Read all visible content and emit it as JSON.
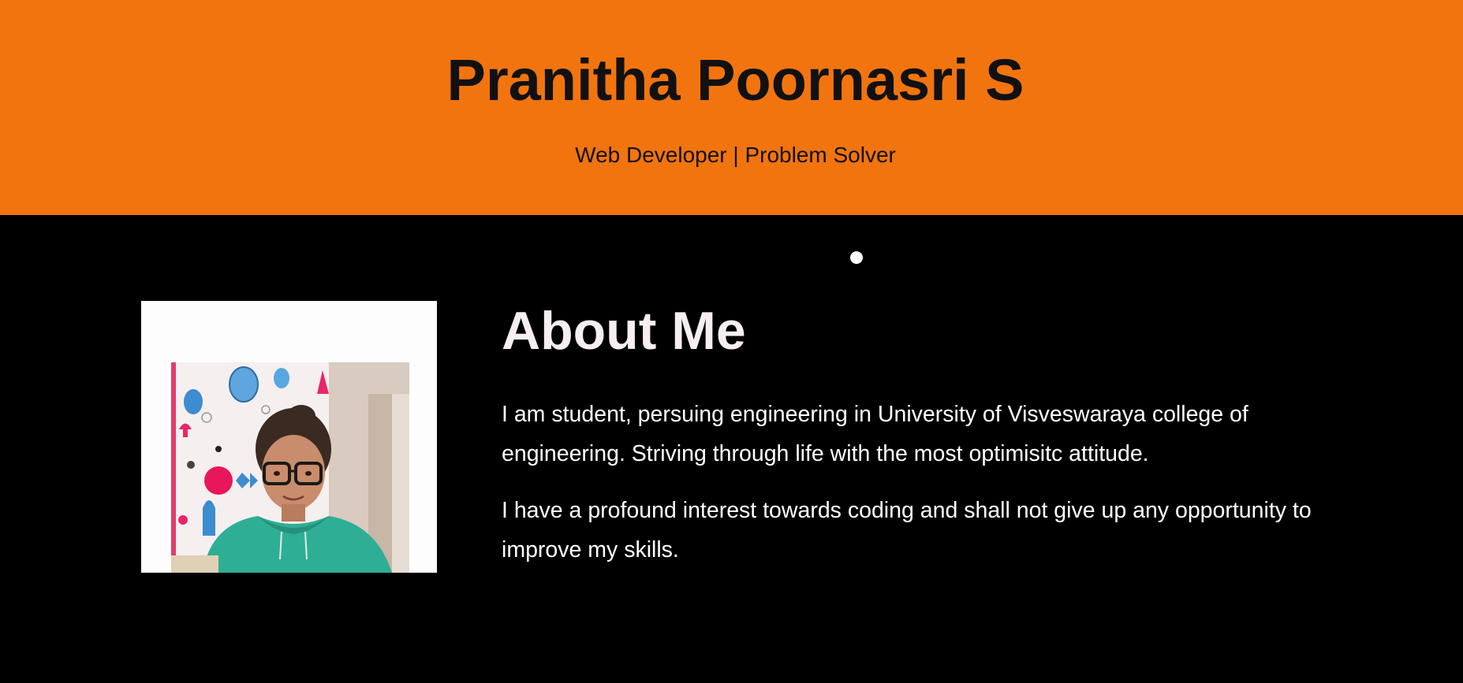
{
  "header": {
    "name": "Pranitha Poornasri S",
    "tagline": "Web Developer | Problem Solver"
  },
  "about": {
    "title": "About Me",
    "paragraphs": [
      "I am student, persuing engineering in University of Visveswaraya college of engineering. Striving through life with the most optimisitc attitude.",
      "I have a profound interest towards coding and shall not give up any opportunity to improve my skills."
    ]
  },
  "colors": {
    "header_bg": "#f2740f",
    "page_bg": "#000000",
    "title_text": "#111111",
    "body_text": "#ffffff"
  }
}
